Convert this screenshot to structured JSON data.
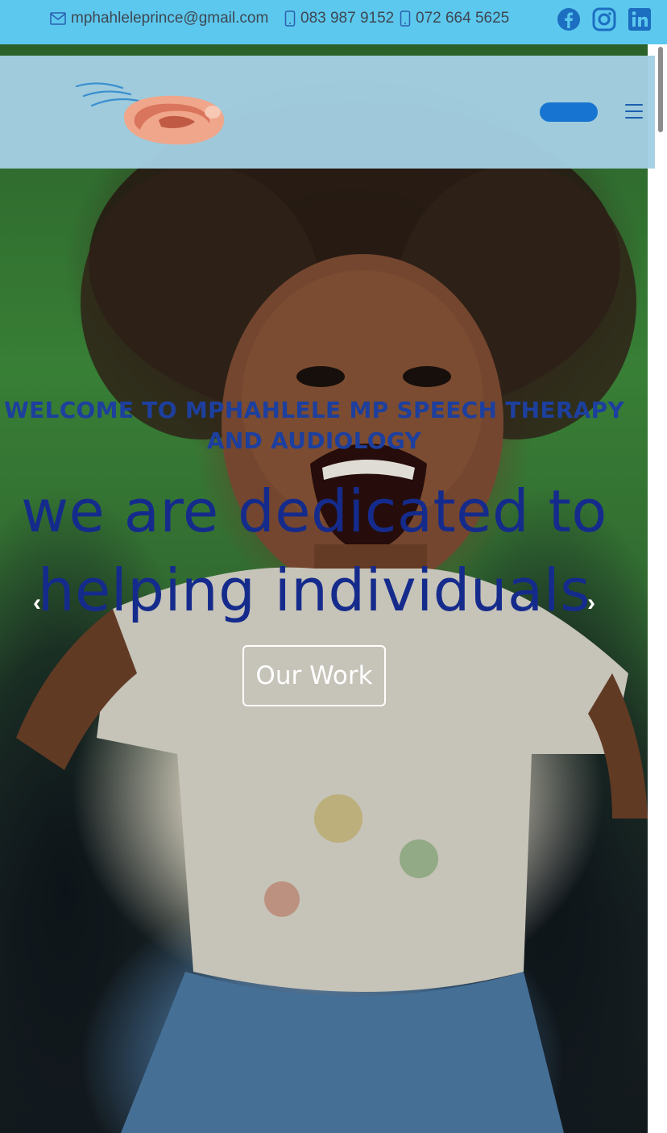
{
  "topbar": {
    "email": "mphahleleprince@gmail.com",
    "phone_1": "083 987 9152",
    "phone_2": "072 664 5625",
    "social": [
      "facebook-icon",
      "instagram-icon",
      "linkedin-icon"
    ]
  },
  "hero": {
    "welcome": "WELCOME TO MPHAHLELE MP SPEECH THERAPY AND AUDIOLOGY",
    "tagline": "we are dedicated to helping individuals",
    "cta_label": "Our Work",
    "prev_label": "‹",
    "next_label": "›"
  },
  "colors": {
    "topbar": "#5cc8ee",
    "header": "#a3cee2",
    "accent": "#1775d1",
    "heading": "#1d3f9e"
  }
}
